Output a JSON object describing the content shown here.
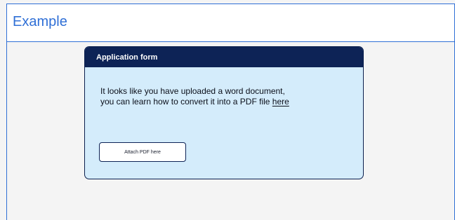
{
  "example": {
    "title": "Example"
  },
  "form": {
    "title": "Application form",
    "message_line1": "It looks like you have uploaded a word document,",
    "message_line2_prefix": "you can learn how to convert it into a PDF file ",
    "link_text": "here",
    "attach_button_label": "Attach PDF here"
  },
  "colors": {
    "accent_blue": "#2f6fd6",
    "navy": "#0d2356",
    "card_background": "#d4ecfb",
    "page_background": "#f4f4f4"
  }
}
